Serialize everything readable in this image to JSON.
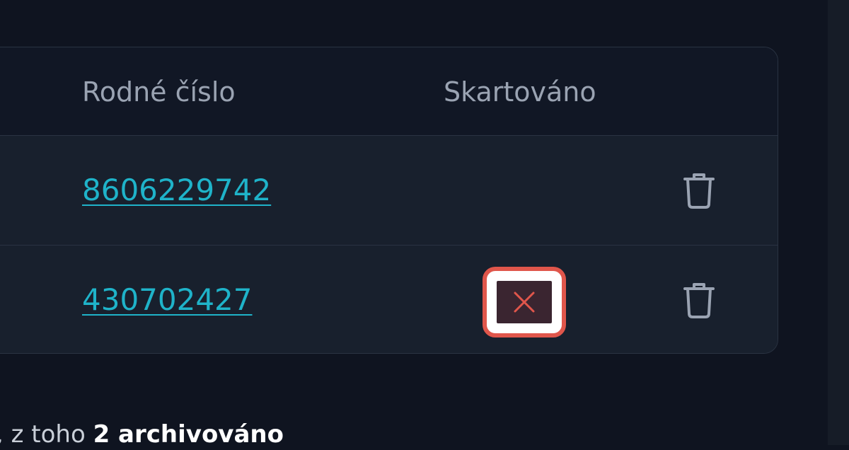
{
  "table": {
    "headers": {
      "rodne_cislo": "Rodné číslo",
      "skartovano": "Skartováno"
    },
    "rows": [
      {
        "rodne_cislo": "8606229742",
        "skartovano": false,
        "delete_icon": "trash-icon"
      },
      {
        "rodne_cislo": "430702427",
        "skartovano": true,
        "skartovano_icon": "x-icon",
        "delete_icon": "trash-icon"
      }
    ]
  },
  "footer": {
    "prefix": ", z toho ",
    "archived_count": "2 archivováno"
  },
  "colors": {
    "link": "#1fb3c9",
    "highlight_border": "#e0564b",
    "x_mark": "#e0564b",
    "background": "#0f1420"
  }
}
